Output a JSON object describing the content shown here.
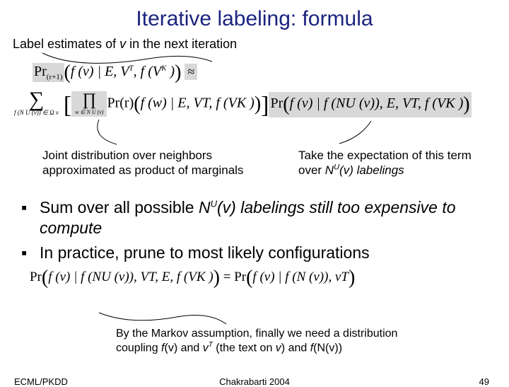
{
  "title": "Iterative labeling: formula",
  "subhead_before": "Label estimates of ",
  "subhead_v": "v",
  "subhead_after": " in the next iteration",
  "formula1": {
    "pr": "Pr",
    "rsub": "(r+1)",
    "body": "f (v) | E, V",
    "supT": "T",
    "mid2": ", f (V",
    "supK": "K",
    "tail": " )",
    "approx": "≈"
  },
  "formula2": {
    "sigma_under": "f (N U (v)) ∈ Ω v",
    "prod_under": "w ∈ N U (v)",
    "pr": "Pr",
    "rsub": "(r)",
    "inner1": "f (w) | E, V",
    "supT": "T",
    "inner_mid": ", f (V",
    "supK": "K",
    "inner_tail": " )",
    "outer_pr": "Pr",
    "outer_body": "f (v) | f (N",
    "supU": "U",
    "outer_mid": " (v)), E, V",
    "outer_tail": ", f (V",
    "outer_close": " )"
  },
  "annot_left": "Joint distribution over neighbors approximated as product of marginals",
  "annot_right_a": "Take the expectation of this term over ",
  "annot_right_N": "N",
  "annot_right_U": "U",
  "annot_right_b": "(v) labelings",
  "bullet1_a": "Sum over all possible ",
  "bullet1_N": "N",
  "bullet1_U": "U",
  "bullet1_b": "(v) labelings still too expensive to compute",
  "bullet2": "In practice, prune to most likely configurations",
  "formula3": {
    "pr": "Pr",
    "lhs_a": "f (v) | f (N",
    "supU": "U",
    "lhs_b": " (v)), V",
    "supT": "T",
    "lhs_c": ", E, f (V",
    "supK": "K",
    "lhs_d": " )",
    "eq": "= ",
    "rhs_a": "f (v) | f (N (v)), v",
    "rhs_tail": ""
  },
  "bottom_a": "By the Markov assumption, finally we need a distribution coupling ",
  "bottom_fv": "f",
  "bottom_paren1": "(v)",
  "bottom_and1": " and ",
  "bottom_v": "v",
  "bottom_T": "T",
  "bottom_text": " (the text on ",
  "bottom_v2": "v",
  "bottom_close": ") and ",
  "bottom_fN": "f",
  "bottom_paren2": "(N(v))",
  "footer_left": "ECML/PKDD",
  "footer_center": "Chakrabarti 2004",
  "footer_right": "49"
}
